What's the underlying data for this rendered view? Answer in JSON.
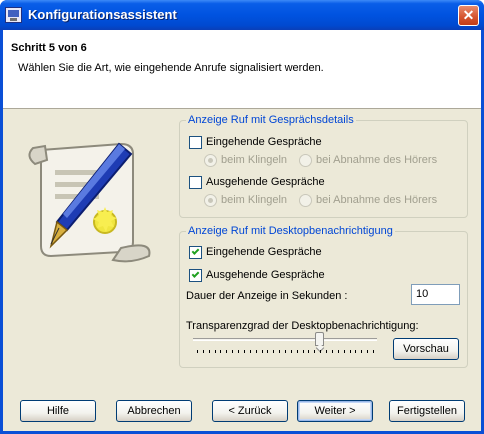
{
  "window": {
    "title": "Konfigurationsassistent",
    "close_glyph": "✕",
    "app_icon": "computer-phone-icon"
  },
  "header": {
    "step": "Schritt 5 von 6",
    "instruction": "Wählen Sie die Art, wie eingehende Anrufe signalisiert werden."
  },
  "illustration": {
    "icon": "certificate-scroll-with-fountain-pen-icon"
  },
  "call_details": {
    "legend": "Anzeige Ruf mit Gesprächsdetails",
    "incoming": {
      "label": "Eingehende Gespräche",
      "checked": false
    },
    "incoming_options": [
      "beim Klingeln",
      "bei Abnahme des Hörers"
    ],
    "outgoing": {
      "label": "Ausgehende Gespräche",
      "checked": false
    },
    "outgoing_options": [
      "beim Klingeln",
      "bei Abnahme des Hörers"
    ]
  },
  "desktop_notification": {
    "legend": "Anzeige Ruf mit Desktopbenachrichtigung",
    "incoming": {
      "label": "Eingehende Gespräche",
      "checked": true
    },
    "outgoing": {
      "label": "Ausgehende Gespräche",
      "checked": true
    },
    "duration_label": "Dauer der Anzeige in Sekunden :",
    "duration_value": "10",
    "transparency_label": "Transparenzgrad der Desktopbenachrichtigung:",
    "transparency_level": 0.7,
    "preview_button": "Vorschau"
  },
  "buttons": {
    "help": "Hilfe",
    "cancel": "Abbrechen",
    "back": "< Zurück",
    "next": "Weiter >",
    "finish": "Fertigstellen"
  },
  "colors": {
    "titlebar": "#0053e0",
    "legend": "#0046d5",
    "dialog_bg": "#ece9d8",
    "checkmark": "#21a121"
  }
}
